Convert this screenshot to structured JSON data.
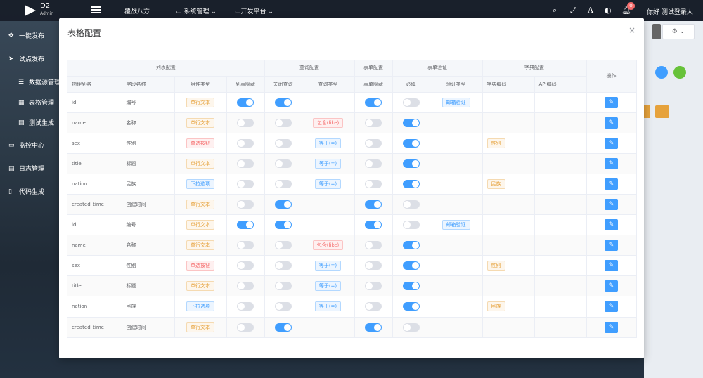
{
  "app": {
    "logo_text": "D2",
    "logo_sub": "Admin"
  },
  "topnav": [
    {
      "label": "覆战八方"
    },
    {
      "label": "系统管理"
    },
    {
      "label": "开发平台"
    }
  ],
  "header": {
    "greeting": "你好 测试登录人",
    "notification_count": "0",
    "font_icon": "A"
  },
  "sidebar": {
    "items": [
      {
        "label": "一键发布",
        "icon": "move-icon"
      },
      {
        "label": "试点发布",
        "icon": "send-icon"
      },
      {
        "label": "数据源管理",
        "icon": "database-icon"
      },
      {
        "label": "表格管理",
        "icon": "grid-icon"
      },
      {
        "label": "测试生成",
        "icon": "table-icon"
      },
      {
        "label": "监控中心",
        "icon": "monitor-icon"
      },
      {
        "label": "日志管理",
        "icon": "document-icon"
      },
      {
        "label": "代码生成",
        "icon": "mobile-icon"
      }
    ]
  },
  "modal": {
    "title": "表格配置",
    "close": "×"
  },
  "table": {
    "groups": [
      {
        "label": "列表配置"
      },
      {
        "label": "查询配置"
      },
      {
        "label": "表单配置"
      },
      {
        "label": "表单验证"
      },
      {
        "label": "字典配置"
      }
    ],
    "headers": {
      "col_name": "物理列名",
      "field_name": "字段名称",
      "component": "组件类型",
      "list_hide": "列表隐藏",
      "query_close": "关闭查询",
      "query_type": "查询类型",
      "form_hide": "表单隐藏",
      "required": "必填",
      "valid_type": "验证类型",
      "dict_code": "字典编码",
      "api_code": "API编码",
      "action": "操作"
    },
    "rows": [
      {
        "col": "id",
        "name": "编号",
        "comp": "单行文本",
        "comp_kind": "warn",
        "list_hide": true,
        "query_close": true,
        "query": "",
        "query_kind": "",
        "form_hide": true,
        "required": false,
        "valid": "邮箱验证",
        "dict": ""
      },
      {
        "col": "name",
        "name": "名称",
        "comp": "单行文本",
        "comp_kind": "warn",
        "list_hide": false,
        "query_close": false,
        "query": "包含(like)",
        "query_kind": "danger",
        "form_hide": false,
        "required": true,
        "valid": "",
        "dict": ""
      },
      {
        "col": "sex",
        "name": "性别",
        "comp": "单选按钮",
        "comp_kind": "danger",
        "list_hide": false,
        "query_close": false,
        "query": "等于(=)",
        "query_kind": "info",
        "form_hide": false,
        "required": true,
        "valid": "",
        "dict": "性别"
      },
      {
        "col": "title",
        "name": "标题",
        "comp": "单行文本",
        "comp_kind": "warn",
        "list_hide": false,
        "query_close": false,
        "query": "等于(=)",
        "query_kind": "info",
        "form_hide": false,
        "required": true,
        "valid": "",
        "dict": ""
      },
      {
        "col": "nation",
        "name": "民族",
        "comp": "下拉选项",
        "comp_kind": "info",
        "list_hide": false,
        "query_close": false,
        "query": "等于(=)",
        "query_kind": "info",
        "form_hide": false,
        "required": true,
        "valid": "",
        "dict": "民族"
      },
      {
        "col": "created_time",
        "name": "创建时间",
        "comp": "单行文本",
        "comp_kind": "warn",
        "list_hide": false,
        "query_close": true,
        "query": "",
        "query_kind": "",
        "form_hide": true,
        "required": false,
        "valid": "",
        "dict": ""
      },
      {
        "col": "id",
        "name": "编号",
        "comp": "单行文本",
        "comp_kind": "warn",
        "list_hide": true,
        "query_close": true,
        "query": "",
        "query_kind": "",
        "form_hide": true,
        "required": false,
        "valid": "邮箱验证",
        "dict": ""
      },
      {
        "col": "name",
        "name": "名称",
        "comp": "单行文本",
        "comp_kind": "warn",
        "list_hide": false,
        "query_close": false,
        "query": "包含(like)",
        "query_kind": "danger",
        "form_hide": false,
        "required": true,
        "valid": "",
        "dict": ""
      },
      {
        "col": "sex",
        "name": "性别",
        "comp": "单选按钮",
        "comp_kind": "danger",
        "list_hide": false,
        "query_close": false,
        "query": "等于(=)",
        "query_kind": "info",
        "form_hide": false,
        "required": true,
        "valid": "",
        "dict": "性别"
      },
      {
        "col": "title",
        "name": "标题",
        "comp": "单行文本",
        "comp_kind": "warn",
        "list_hide": false,
        "query_close": false,
        "query": "等于(=)",
        "query_kind": "info",
        "form_hide": false,
        "required": true,
        "valid": "",
        "dict": ""
      },
      {
        "col": "nation",
        "name": "民族",
        "comp": "下拉选项",
        "comp_kind": "info",
        "list_hide": false,
        "query_close": false,
        "query": "等于(=)",
        "query_kind": "info",
        "form_hide": false,
        "required": true,
        "valid": "",
        "dict": "民族"
      },
      {
        "col": "created_time",
        "name": "创建时间",
        "comp": "单行文本",
        "comp_kind": "warn",
        "list_hide": false,
        "query_close": true,
        "query": "",
        "query_kind": "",
        "form_hide": true,
        "required": false,
        "valid": "",
        "dict": ""
      }
    ]
  },
  "colors": {
    "primary": "#409eff",
    "warning": "#e6a23c",
    "danger": "#f56c6c"
  }
}
